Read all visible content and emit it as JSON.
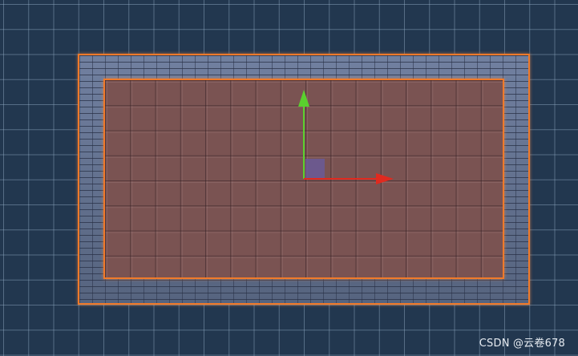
{
  "watermark": {
    "text": "CSDN @云卷678"
  },
  "gizmo": {
    "y_axis_color": "#5ad12e",
    "x_axis_color": "#e02a1f",
    "center_handle_color": "#6a5a98"
  },
  "tilemap": {
    "selection_outline_color": "#f07a2a",
    "wall_color": "#5c6a8a",
    "floor_color": "#7a5352"
  },
  "scene_background_color": "#22374f"
}
